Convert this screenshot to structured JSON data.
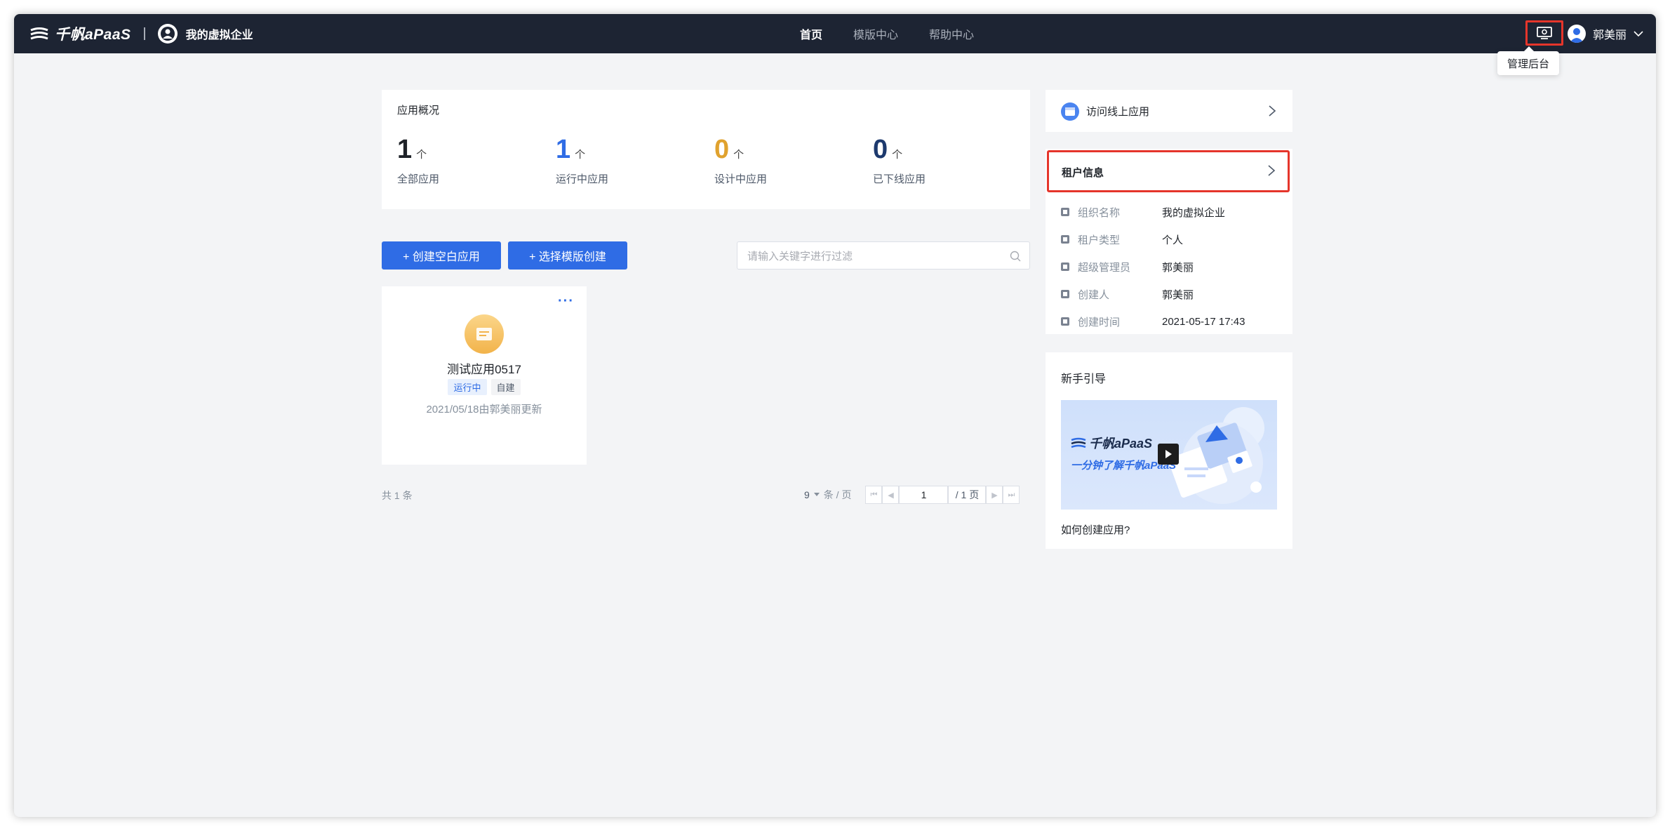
{
  "header": {
    "brand": "千帆aPaaS",
    "org": "我的虚拟企业",
    "nav": [
      {
        "label": "首页",
        "active": true
      },
      {
        "label": "模版中心",
        "active": false
      },
      {
        "label": "帮助中心",
        "active": false
      }
    ],
    "admin_tooltip": "管理后台",
    "user": "郭美丽",
    "admin_icon": "monitor-icon",
    "user_icon": "user-avatar-icon"
  },
  "overview": {
    "title": "应用概况",
    "unit": "个",
    "stats": [
      {
        "value": "1",
        "label": "全部应用",
        "color": "#1f2329"
      },
      {
        "value": "1",
        "label": "运行中应用",
        "color": "#2f6ce5"
      },
      {
        "value": "0",
        "label": "设计中应用",
        "color": "#e0a22e"
      },
      {
        "value": "0",
        "label": "已下线应用",
        "color": "#1d3a6e"
      }
    ]
  },
  "actions": {
    "create_blank": "+ 创建空白应用",
    "create_template": "+ 选择模版创建",
    "search_placeholder": "请输入关键字进行过滤"
  },
  "apps": [
    {
      "name": "测试应用0517",
      "tags": [
        "运行中",
        "自建"
      ],
      "updated": "2021/05/18由郭美丽更新",
      "more": "···"
    }
  ],
  "pagination": {
    "total": "共 1 条",
    "page_size": "9",
    "page_size_suffix": "条 / 页",
    "current": "1",
    "total_pages": "/ 1 页"
  },
  "sidebar": {
    "visit_online": "访问线上应用",
    "tenant": {
      "title": "租户信息",
      "rows": [
        {
          "key": "组织名称",
          "value": "我的虚拟企业"
        },
        {
          "key": "租户类型",
          "value": "个人"
        },
        {
          "key": "超级管理员",
          "value": "郭美丽"
        },
        {
          "key": "创建人",
          "value": "郭美丽"
        },
        {
          "key": "创建时间",
          "value": "2021-05-17 17:43"
        }
      ]
    },
    "guide": {
      "title": "新手引导",
      "brand": "千帆aPaaS",
      "subtitle": "一分钟了解千帆aPaaS",
      "caption": "如何创建应用?"
    }
  },
  "colors": {
    "topbar": "#1d2433",
    "primary": "#2f6ce5",
    "highlight": "#e5352b"
  }
}
